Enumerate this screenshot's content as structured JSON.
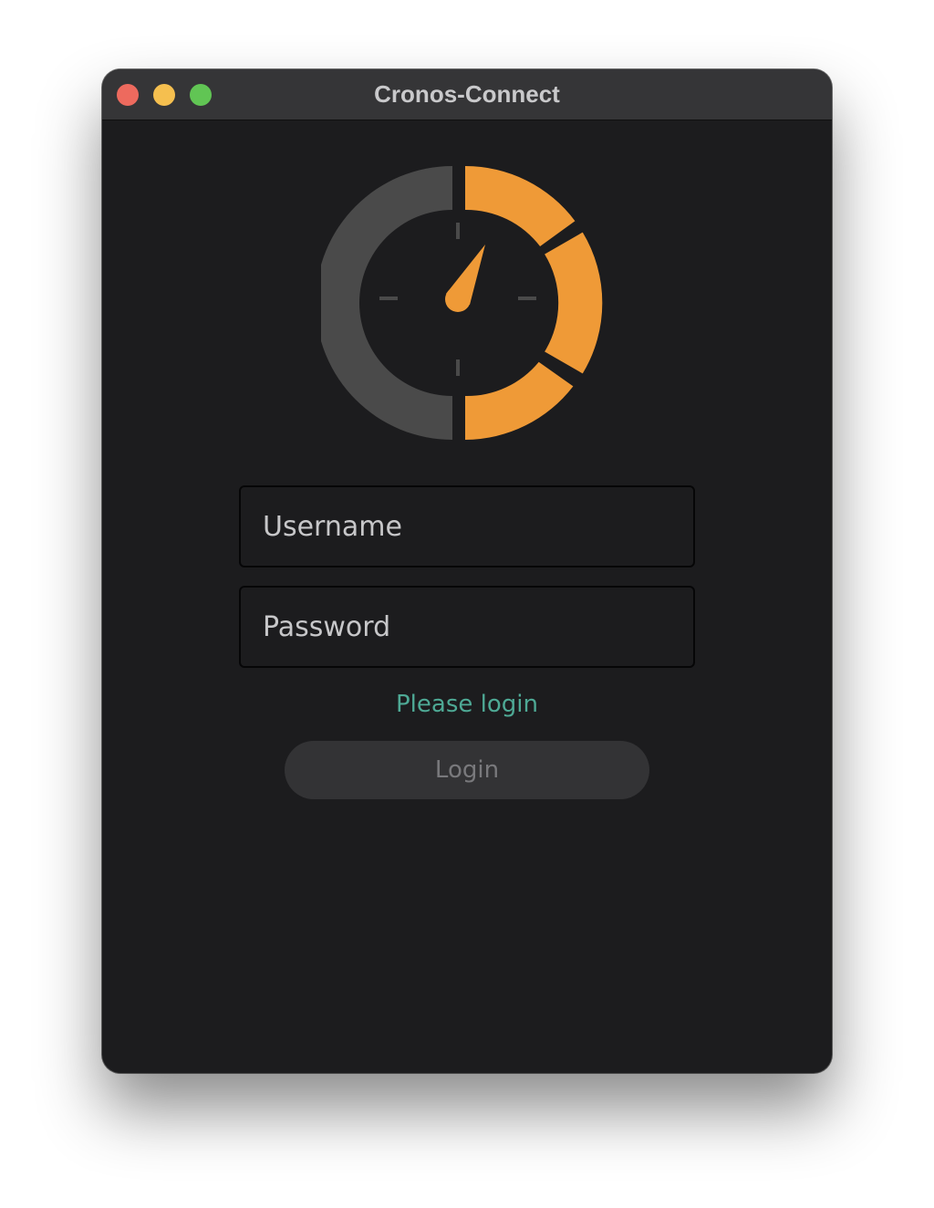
{
  "window": {
    "title": "Cronos-Connect"
  },
  "logo": {
    "icon": "gauge-icon",
    "accent_color": "#ef9a37",
    "track_color": "#4a4a4a"
  },
  "form": {
    "username": {
      "placeholder": "Username",
      "value": ""
    },
    "password": {
      "placeholder": "Password",
      "value": ""
    },
    "status_text": "Please login",
    "status_color": "#4ea995",
    "login_label": "Login"
  }
}
